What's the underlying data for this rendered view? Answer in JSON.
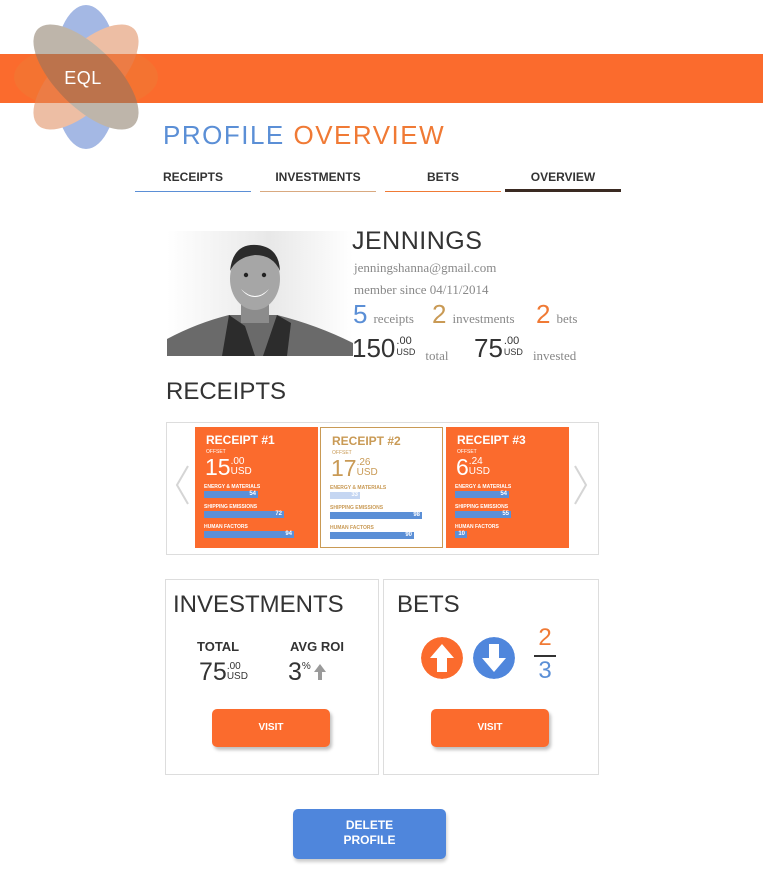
{
  "brand": {
    "logo_text": "EQL",
    "accent": "#fb6b2d",
    "blue": "#5b8fd6",
    "gold": "#c99a55"
  },
  "header": {
    "title_part1": "PROFILE",
    "title_part2": "OVERVIEW"
  },
  "tabs": [
    {
      "label": "RECEIPTS",
      "underline": "#5b8fd6"
    },
    {
      "label": "INVESTMENTS",
      "underline": "#d9a980"
    },
    {
      "label": "BETS",
      "underline": "#f07a35"
    },
    {
      "label": "OVERVIEW",
      "underline": "#3a2a22",
      "active": true
    }
  ],
  "profile": {
    "name": "JENNINGS",
    "email": "jenningshanna@gmail.com",
    "member_since": "member since 04/11/2014",
    "receipts_count": "5",
    "receipts_label": "receipts",
    "investments_count": "2",
    "investments_label": "investments",
    "bets_count": "2",
    "bets_label": "bets",
    "total_amount": "150",
    "total_cents": ".00",
    "total_currency": "USD",
    "total_label": "total",
    "invested_amount": "75",
    "invested_cents": ".00",
    "invested_currency": "USD",
    "invested_label": "invested"
  },
  "receipts_section": {
    "title": "RECEIPTS",
    "cards": [
      {
        "title": "RECEIPT #1",
        "offset_label": "OFFSET",
        "amount": "15",
        "cents": ".00",
        "currency": "USD",
        "energy_label": "ENERGY & MATERIALS",
        "energy": 54,
        "shipping_label": "SHIPPING EMISSIONS",
        "shipping": 72,
        "human_label": "HUMAN FACTORS",
        "human": 94
      },
      {
        "title": "RECEIPT #2",
        "offset_label": "OFFSET",
        "amount": "17",
        "cents": ".26",
        "currency": "USD",
        "energy_label": "ENERGY & MATERIALS",
        "energy": 33,
        "shipping_label": "SHIPPING EMISSIONS",
        "shipping": 98,
        "human_label": "HUMAN FACTORS",
        "human": 90
      },
      {
        "title": "RECEIPT #3",
        "offset_label": "OFFSET",
        "amount": "6",
        "cents": ".24",
        "currency": "USD",
        "energy_label": "ENERGY & MATERIALS",
        "energy": 54,
        "shipping_label": "SHIPPING EMISSIONS",
        "shipping": 55,
        "human_label": "HUMAN FACTORS",
        "human": 10
      }
    ]
  },
  "investments_panel": {
    "title": "INVESTMENTS",
    "total_label": "TOTAL",
    "total_amount": "75",
    "total_cents": ".00",
    "total_currency": "USD",
    "roi_label": "AVG ROI",
    "roi_value": "3",
    "roi_unit": "%",
    "visit_label": "VISIT"
  },
  "bets_panel": {
    "title": "BETS",
    "fraction_top": "2",
    "fraction_bottom": "3",
    "visit_label": "VISIT"
  },
  "delete_button": {
    "line1": "DELETE",
    "line2": "PROFILE"
  }
}
